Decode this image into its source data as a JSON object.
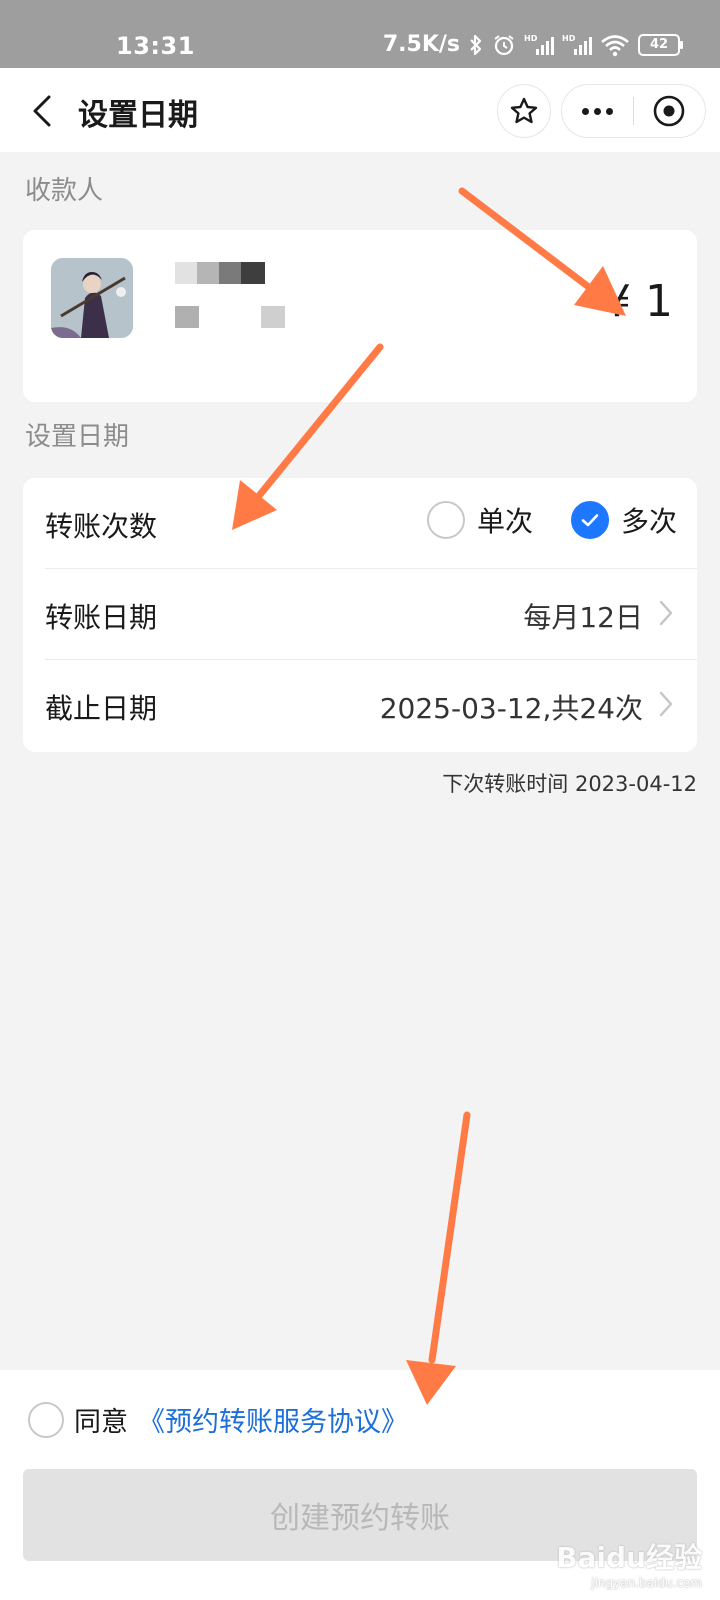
{
  "status_bar": {
    "time": "13:31",
    "network_speed": "7.5K/s",
    "battery": "42",
    "icons": [
      "bluetooth-icon",
      "alarm-icon",
      "signal-hd-icon",
      "signal-hd-icon",
      "wifi-icon",
      "battery-icon"
    ]
  },
  "nav": {
    "back_icon": "chevron-left-icon",
    "title": "设置日期",
    "favorite_icon": "star-icon",
    "more_icon": "more-icon",
    "close_icon": "target-icon"
  },
  "payee": {
    "section_label": "收款人",
    "amount": "¥ 1"
  },
  "schedule": {
    "section_label": "设置日期",
    "count_label": "转账次数",
    "options": [
      {
        "label": "单次",
        "checked": false
      },
      {
        "label": "多次",
        "checked": true
      }
    ],
    "date_label": "转账日期",
    "date_value": "每月12日",
    "end_label": "截止日期",
    "end_value": "2025-03-12,共24次",
    "next_time": "下次转账时间 2023-04-12"
  },
  "agreement": {
    "prefix": "同意",
    "link": "《预约转账服务协议》"
  },
  "create_button": "创建预约转账",
  "watermark": {
    "brand": "Baidu经验",
    "url": "jingyan.baidu.com"
  },
  "colors": {
    "accent": "#1e78ff",
    "link": "#1e6fd9",
    "annotation_arrow": "#ff7a45",
    "status_bar": "#9e9e9e",
    "background": "#f3f3f3"
  }
}
